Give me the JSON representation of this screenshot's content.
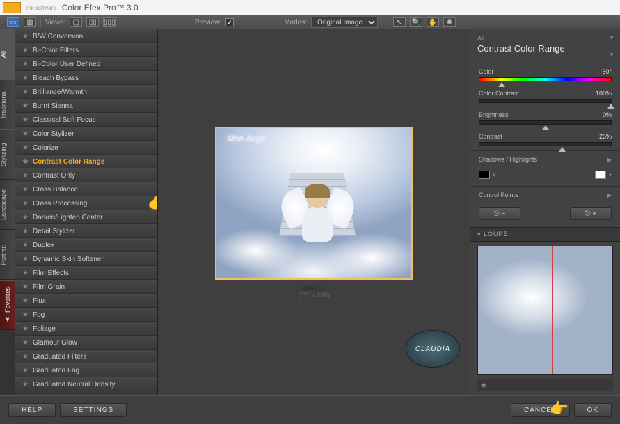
{
  "app": {
    "title": "Color Efex Pro™ 3.0",
    "vendor": "nik software"
  },
  "toolbar": {
    "views": "Views:",
    "preview": "Preview:",
    "preview_checked": "✓",
    "modes": "Modes:",
    "mode_value": "Original Image"
  },
  "vtabs": [
    "All",
    "Traditional",
    "Stylizing",
    "Landscape",
    "Portrait"
  ],
  "vtab_fav": "Favorites",
  "filters": [
    "B/W Conversion",
    "Bi-Color Filters",
    "Bi-Color User Defined",
    "Bleach Bypass",
    "Brilliance/Warmth",
    "Burnt Sienna",
    "Classical Soft Focus",
    "Color Stylizer",
    "Colorize",
    "Contrast Color Range",
    "Contrast Only",
    "Cross Balance",
    "Cross Processing",
    "Darken/Lighten Center",
    "Detail Stylizer",
    "Duplex",
    "Dynamic Skin Softener",
    "Film Effects",
    "Film Grain",
    "Flux",
    "Fog",
    "Foliage",
    "Glamour Glow",
    "Graduated Filters",
    "Graduated Fog",
    "Graduated Neutral Density"
  ],
  "selected_filter_index": 9,
  "preview_area": {
    "overlay_text": "Mon Ange",
    "image_name": "Image1",
    "image_dims": "(870 x 670)",
    "badge": "CLAUDIA"
  },
  "right": {
    "category": "All",
    "filter_name": "Contrast Color Range",
    "sliders": [
      {
        "label": "Color",
        "value": "60°",
        "pos": 17,
        "hue": true
      },
      {
        "label": "Color Contrast",
        "value": "100%",
        "pos": 100
      },
      {
        "label": "Brightness",
        "value": "0%",
        "pos": 50
      },
      {
        "label": "Contrast",
        "value": "25%",
        "pos": 63
      }
    ],
    "shadows_label": "Shadows / Highlights",
    "control_points_label": "Control Points",
    "loupe_label": "LOUPE"
  },
  "footer": {
    "help": "HELP",
    "settings": "SETTINGS",
    "cancel": "CANCEL",
    "ok": "OK"
  }
}
